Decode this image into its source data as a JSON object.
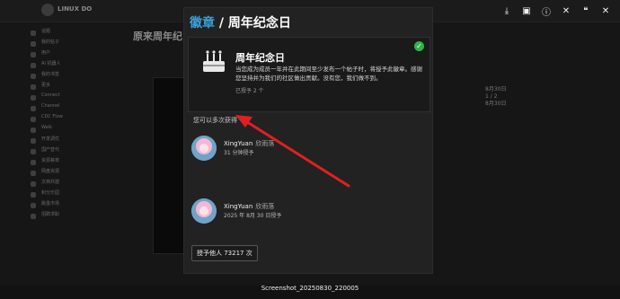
{
  "background": {
    "logo_text": "LINUX DO",
    "title": "原来周年纪",
    "sidebar_items": [
      "话题",
      "我的帖子",
      "用户",
      "AI 机器人",
      "我的书签",
      "更多",
      "Connect",
      "Channel",
      "CDC Flow",
      "Walk",
      "开发调优",
      "国产替代",
      "资源荟萃",
      "网盘资源",
      "文档共建",
      "积分乐园",
      "跳蚤市场",
      "招聘求职"
    ],
    "timeline_date": "8月30日",
    "timeline_count": "1 / 2",
    "timeline_date2": "8月30日"
  },
  "toolbar": {
    "icons": [
      "download-icon",
      "image-icon",
      "info-icon",
      "close-icon",
      "quote-icon",
      "close-icon-2"
    ]
  },
  "viewer": {
    "heading_link": "徽章",
    "heading_sep": " / ",
    "heading_page": "周年纪念日",
    "badge_name": "周年纪念日",
    "badge_desc": "当您成为成员一年并在此期间至少发布一个帖子时，将授予此徽章。感谢您坚持并为我们的社区做出贡献。没有您，我们做不到。",
    "badge_count": "已授予 2 个",
    "multi_label": "您可以多次获得",
    "grants": [
      {
        "name": "XingYuan",
        "sub": "欣雨落",
        "time": "31 分钟授予"
      },
      {
        "name": "XingYuan",
        "sub": "欣雨落",
        "time": "2025 年 8月 30 日授予"
      }
    ],
    "grant_others": "授予他人 73217 次"
  },
  "caption": "Screenshot_20250830_220005",
  "colors": {
    "link": "#3aa0d8",
    "check": "#2fb34a",
    "arrow": "#e02020"
  }
}
